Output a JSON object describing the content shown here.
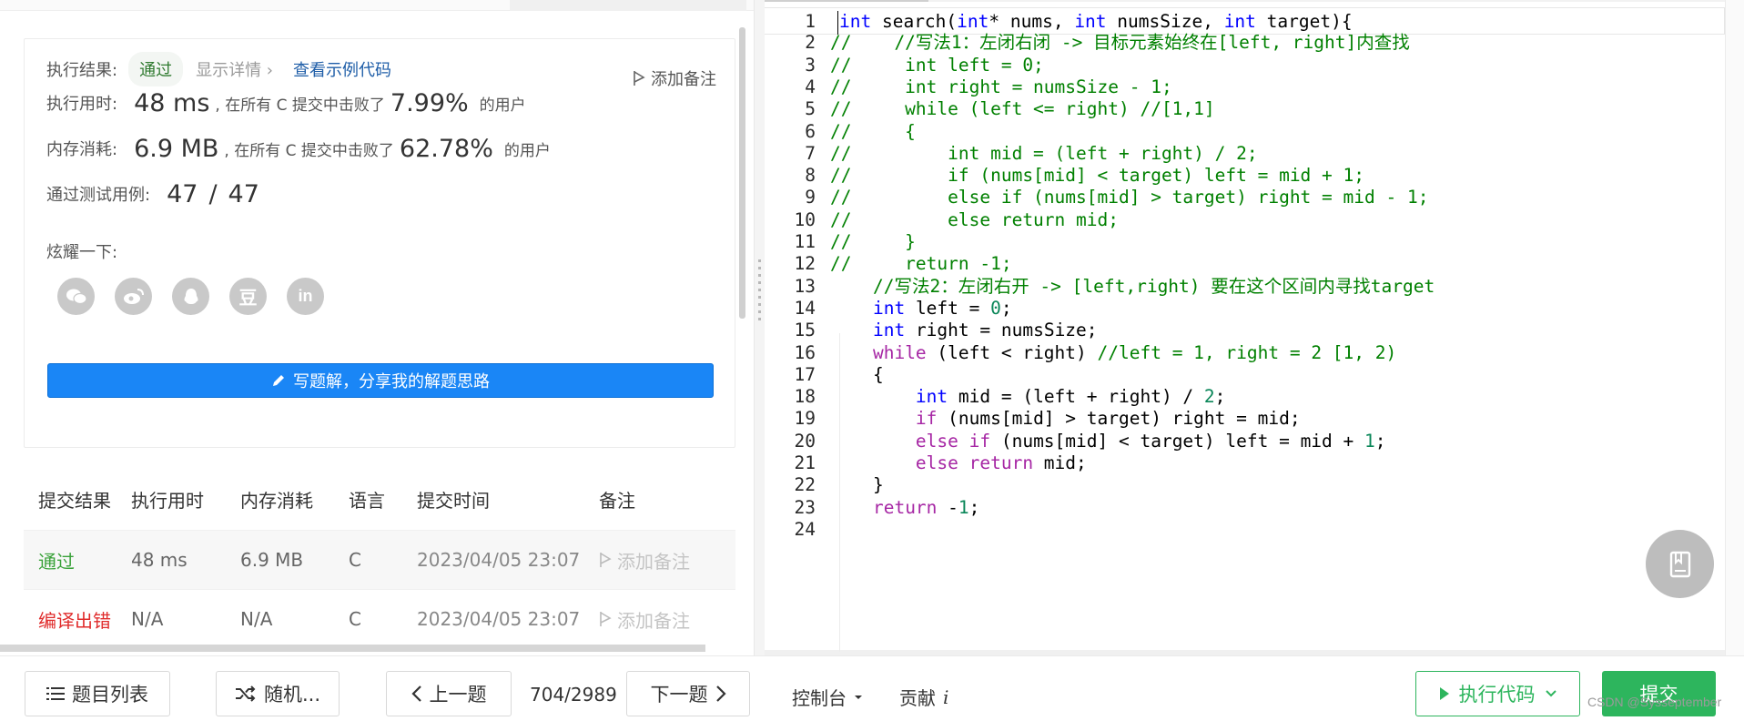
{
  "result": {
    "label": "执行结果:",
    "status": "通过",
    "details": "显示详情 ›",
    "sample_link": "查看示例代码",
    "add_note": "添加备注"
  },
  "runtime": {
    "label": "执行用时:",
    "value": "48 ms",
    "mid": ", 在所有 C 提交中击败了",
    "pct": "7.99%",
    "tail": "的用户"
  },
  "memory": {
    "label": "内存消耗:",
    "value": "6.9 MB",
    "mid": ", 在所有 C 提交中击败了",
    "pct": "62.78%",
    "tail": "的用户"
  },
  "tests": {
    "label": "通过测试用例:",
    "passed": "47",
    "sep": "/",
    "total": "47"
  },
  "share": {
    "label": "炫耀一下:",
    "icons": [
      "wechat-icon",
      "weibo-icon",
      "qq-icon",
      "douban-icon",
      "linkedin-icon"
    ]
  },
  "write_solution": "写题解，分享我的解题思路",
  "submissions": {
    "headers": [
      "提交结果",
      "执行用时",
      "内存消耗",
      "语言",
      "提交时间",
      "备注"
    ],
    "rows": [
      {
        "result": "通过",
        "time": "48 ms",
        "memory": "6.9 MB",
        "lang": "C",
        "submitted": "2023/04/05 23:07",
        "note": "添加备注"
      },
      {
        "result": "编译出错",
        "time": "N/A",
        "memory": "N/A",
        "lang": "C",
        "submitted": "2023/04/05 23:07",
        "note": "添加备注"
      }
    ]
  },
  "editor": {
    "lines": [
      {
        "n": "1",
        "tokens": [
          [
            "kw",
            "int"
          ],
          [
            "txt",
            " search("
          ],
          [
            "kw",
            "int"
          ],
          [
            "txt",
            "* nums, "
          ],
          [
            "kw",
            "int"
          ],
          [
            "txt",
            " numsSize, "
          ],
          [
            "kw",
            "int"
          ],
          [
            "txt",
            " target){"
          ]
        ]
      },
      {
        "n": "2",
        "tokens": [
          [
            "com",
            "//    //写法1：左闭右闭 -> 目标元素始终在[left, right]内查找"
          ]
        ]
      },
      {
        "n": "3",
        "tokens": [
          [
            "com",
            "//     int left = 0;"
          ]
        ]
      },
      {
        "n": "4",
        "tokens": [
          [
            "com",
            "//     int right = numsSize - 1;"
          ]
        ]
      },
      {
        "n": "5",
        "tokens": [
          [
            "com",
            "//     while (left <= right) //[1,1]"
          ]
        ]
      },
      {
        "n": "6",
        "tokens": [
          [
            "com",
            "//     {"
          ]
        ]
      },
      {
        "n": "7",
        "tokens": [
          [
            "com",
            "//         int mid = (left + right) / 2;"
          ]
        ]
      },
      {
        "n": "8",
        "tokens": [
          [
            "com",
            "//         if (nums[mid] < target) left = mid + 1;"
          ]
        ]
      },
      {
        "n": "9",
        "tokens": [
          [
            "com",
            "//         else if (nums[mid] > target) right = mid - 1;"
          ]
        ]
      },
      {
        "n": "10",
        "tokens": [
          [
            "com",
            "//         else return mid;"
          ]
        ]
      },
      {
        "n": "11",
        "tokens": [
          [
            "com",
            "//     }"
          ]
        ]
      },
      {
        "n": "12",
        "tokens": [
          [
            "com",
            "//     return -1;"
          ]
        ]
      },
      {
        "n": "13",
        "tokens": [
          [
            "txt",
            "    "
          ],
          [
            "com",
            "//写法2：左闭右开 -> [left,right) 要在这个区间内寻找target"
          ]
        ]
      },
      {
        "n": "14",
        "tokens": [
          [
            "txt",
            "    "
          ],
          [
            "kw",
            "int"
          ],
          [
            "txt",
            " left = "
          ],
          [
            "num",
            "0"
          ],
          [
            "txt",
            ";"
          ]
        ]
      },
      {
        "n": "15",
        "tokens": [
          [
            "txt",
            "    "
          ],
          [
            "kw",
            "int"
          ],
          [
            "txt",
            " right = numsSize;"
          ]
        ]
      },
      {
        "n": "16",
        "tokens": [
          [
            "txt",
            "    "
          ],
          [
            "kw2",
            "while"
          ],
          [
            "txt",
            " (left < right) "
          ],
          [
            "com",
            "//left = 1, right = 2 [1, 2)"
          ]
        ]
      },
      {
        "n": "17",
        "tokens": [
          [
            "txt",
            "    {"
          ]
        ]
      },
      {
        "n": "18",
        "tokens": [
          [
            "txt",
            "        "
          ],
          [
            "kw",
            "int"
          ],
          [
            "txt",
            " mid = (left + right) / "
          ],
          [
            "num",
            "2"
          ],
          [
            "txt",
            ";"
          ]
        ]
      },
      {
        "n": "19",
        "tokens": [
          [
            "txt",
            "        "
          ],
          [
            "kw2",
            "if"
          ],
          [
            "txt",
            " (nums[mid] > target) right = mid;"
          ]
        ]
      },
      {
        "n": "20",
        "tokens": [
          [
            "txt",
            "        "
          ],
          [
            "kw2",
            "else if"
          ],
          [
            "txt",
            " (nums[mid] < target) left = mid + "
          ],
          [
            "num",
            "1"
          ],
          [
            "txt",
            ";"
          ]
        ]
      },
      {
        "n": "21",
        "tokens": [
          [
            "txt",
            "        "
          ],
          [
            "kw2",
            "else return"
          ],
          [
            "txt",
            " mid;"
          ]
        ]
      },
      {
        "n": "22",
        "tokens": [
          [
            "txt",
            "    }"
          ]
        ]
      },
      {
        "n": "23",
        "tokens": [
          [
            "txt",
            "    "
          ],
          [
            "kw2",
            "return"
          ],
          [
            "txt",
            " -"
          ],
          [
            "num",
            "1"
          ],
          [
            "txt",
            ";"
          ]
        ]
      },
      {
        "n": "24",
        "tokens": []
      }
    ]
  },
  "bottom": {
    "problem_list": "题目列表",
    "random": "随机...",
    "prev": "上一题",
    "counter": "704/2989",
    "next": "下一题",
    "console": "控制台",
    "contribute": "贡献",
    "contribute_icon": "i",
    "run": "执行代码",
    "submit": "提交",
    "watermark": "CSDN @Sysseptember"
  },
  "colors": {
    "accent_blue": "#1a86f6",
    "pass_green": "#3aa23a",
    "error_red": "#e02c2c",
    "submit_green": "#2db55d"
  }
}
